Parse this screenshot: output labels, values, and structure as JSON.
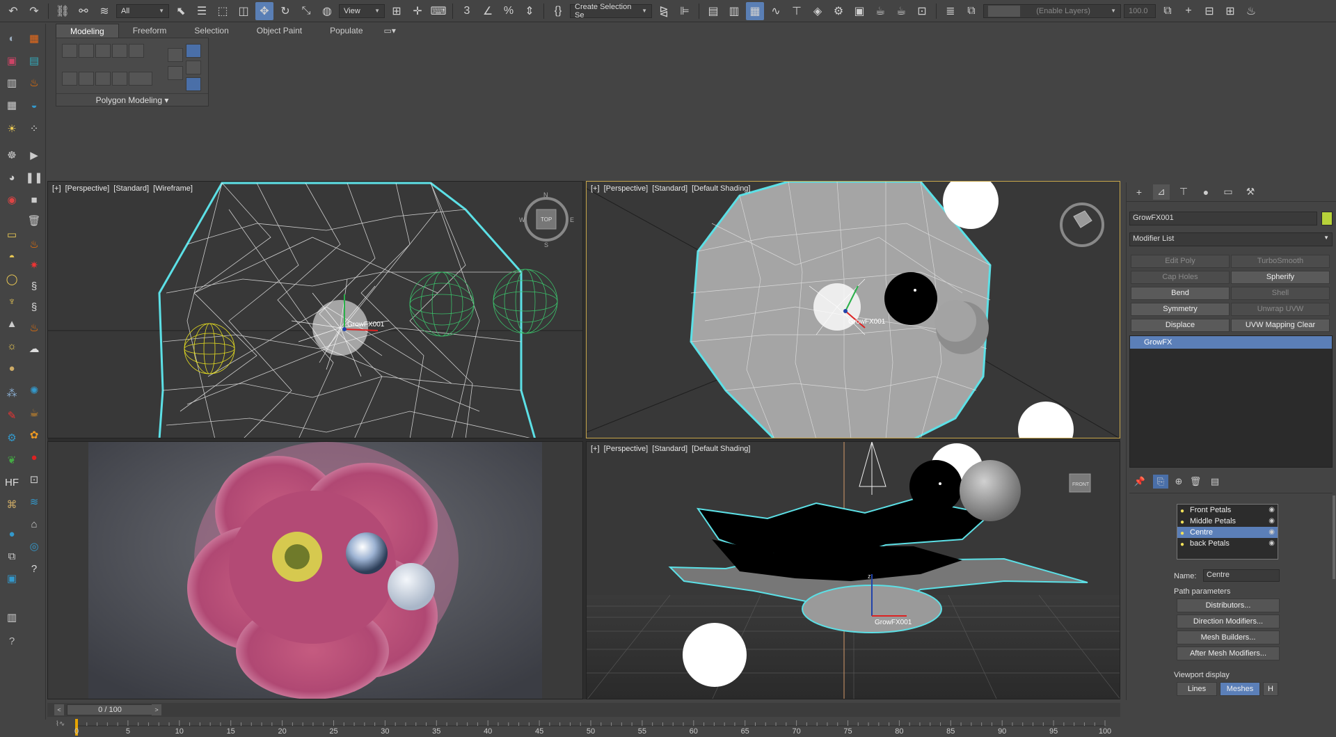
{
  "toolbar": {
    "selection_filter": "All",
    "reference_coord": "View",
    "named_selection": "Create Selection Se",
    "layers_placeholder": "(Enable Layers)",
    "layers_value": "100.0"
  },
  "ribbon": {
    "tabs": [
      "Modeling",
      "Freeform",
      "Selection",
      "Object Paint",
      "Populate"
    ],
    "panel_label": "Polygon Modeling"
  },
  "viewports": {
    "top_left": {
      "view": "[+]",
      "type": "[Perspective]",
      "preset": "[Standard]",
      "shading": "[Wireframe]",
      "object_label": "GrowFX001",
      "compass": {
        "n": "N",
        "s": "S",
        "w": "W",
        "e": "E",
        "cube": "TOP"
      }
    },
    "top_right": {
      "view": "[+]",
      "type": "[Perspective]",
      "preset": "[Standard]",
      "shading": "[Default Shading]",
      "object_label": "GrowFX001"
    },
    "bottom_right": {
      "view": "[+]",
      "type": "[Perspective]",
      "preset": "[Standard]",
      "shading": "[Default Shading]",
      "object_label": "GrowFX001",
      "view_cube": "FRONT"
    }
  },
  "command_panel": {
    "object_name": "GrowFX001",
    "object_color": "#b7d23a",
    "modifier_list": "Modifier List",
    "modifier_buttons": [
      {
        "label": "Edit Poly",
        "enabled": false
      },
      {
        "label": "TurboSmooth",
        "enabled": false
      },
      {
        "label": "Cap Holes",
        "enabled": false
      },
      {
        "label": "Spherify",
        "enabled": true
      },
      {
        "label": "Bend",
        "enabled": true
      },
      {
        "label": "Shell",
        "enabled": false
      },
      {
        "label": "Symmetry",
        "enabled": true
      },
      {
        "label": "Unwrap UVW",
        "enabled": false
      },
      {
        "label": "Displace",
        "enabled": true
      },
      {
        "label": "UVW Mapping Clear",
        "enabled": true
      }
    ],
    "stack_item": "GrowFX",
    "paths": [
      {
        "label": "Front Petals",
        "selected": false
      },
      {
        "label": "Middle Petals",
        "selected": false
      },
      {
        "label": "Centre",
        "selected": true
      },
      {
        "label": "back Petals",
        "selected": false
      }
    ],
    "name_label": "Name:",
    "name_value": "Centre",
    "path_parameters_title": "Path parameters",
    "path_buttons": [
      "Distributors...",
      "Direction Modifiers...",
      "Mesh Builders...",
      "After Mesh Modifiers..."
    ],
    "viewport_display_title": "Viewport display",
    "viewport_display_buttons": [
      "Lines",
      "Meshes",
      "H"
    ]
  },
  "time_slider": {
    "frame": "0 / 100"
  },
  "track_bar": {
    "ticks": [
      "0",
      "5",
      "10",
      "15",
      "20",
      "25",
      "30",
      "35",
      "40",
      "45",
      "50",
      "55",
      "60",
      "65",
      "70",
      "75",
      "80",
      "85",
      "90",
      "95",
      "100"
    ]
  }
}
